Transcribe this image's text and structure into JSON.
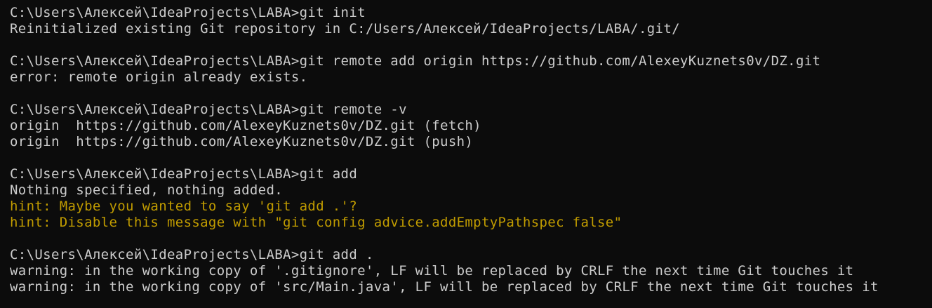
{
  "colors": {
    "background": "#0c0c0c",
    "foreground": "#cccccc",
    "hint": "#c19c00"
  },
  "terminal": {
    "lines": [
      {
        "text": "C:\\Users\\Алексей\\IdeaProjects\\LABA>git init",
        "kind": "prompt"
      },
      {
        "text": "Reinitialized existing Git repository in C:/Users/Алексей/IdeaProjects/LABA/.git/",
        "kind": "output"
      },
      {
        "text": "",
        "kind": "blank"
      },
      {
        "text": "C:\\Users\\Алексей\\IdeaProjects\\LABA>git remote add origin https://github.com/AlexeyKuznets0v/DZ.git",
        "kind": "prompt"
      },
      {
        "text": "error: remote origin already exists.",
        "kind": "output"
      },
      {
        "text": "",
        "kind": "blank"
      },
      {
        "text": "C:\\Users\\Алексей\\IdeaProjects\\LABA>git remote -v",
        "kind": "prompt"
      },
      {
        "text": "origin  https://github.com/AlexeyKuznets0v/DZ.git (fetch)",
        "kind": "output"
      },
      {
        "text": "origin  https://github.com/AlexeyKuznets0v/DZ.git (push)",
        "kind": "output"
      },
      {
        "text": "",
        "kind": "blank"
      },
      {
        "text": "C:\\Users\\Алексей\\IdeaProjects\\LABA>git add",
        "kind": "prompt"
      },
      {
        "text": "Nothing specified, nothing added.",
        "kind": "output"
      },
      {
        "text": "hint: Maybe you wanted to say 'git add .'?",
        "kind": "hint"
      },
      {
        "text": "hint: Disable this message with \"git config advice.addEmptyPathspec false\"",
        "kind": "hint"
      },
      {
        "text": "",
        "kind": "blank"
      },
      {
        "text": "C:\\Users\\Алексей\\IdeaProjects\\LABA>git add .",
        "kind": "prompt"
      },
      {
        "text": "warning: in the working copy of '.gitignore', LF will be replaced by CRLF the next time Git touches it",
        "kind": "output"
      },
      {
        "text": "warning: in the working copy of 'src/Main.java', LF will be replaced by CRLF the next time Git touches it",
        "kind": "output"
      }
    ]
  }
}
